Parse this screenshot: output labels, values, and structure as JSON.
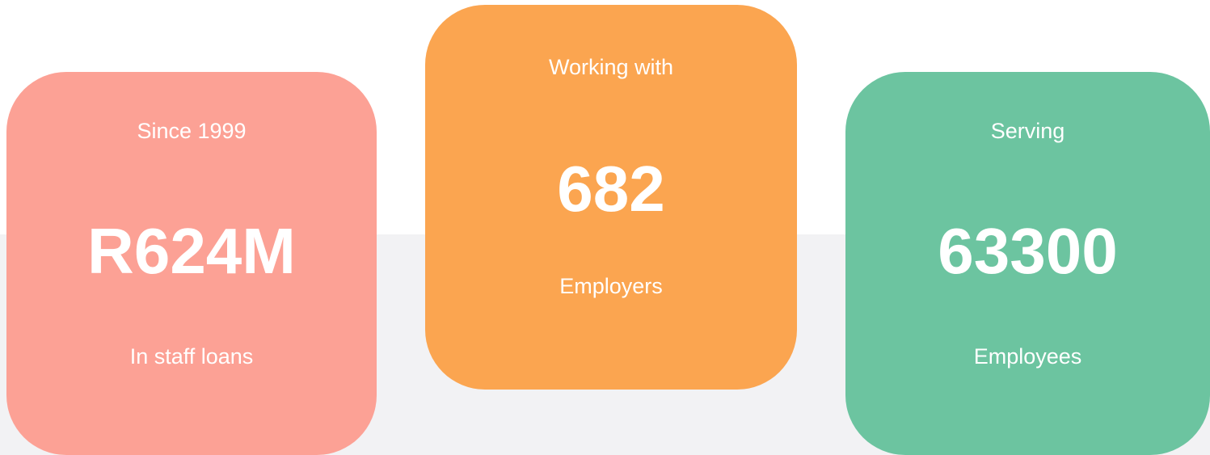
{
  "colors": {
    "background": "#ffffff",
    "band": "#f2f2f4",
    "text": "#ffffff"
  },
  "stats": [
    {
      "top_text": "Since 1999",
      "value": "R624M",
      "bottom_text": "In staff loans",
      "color": "#fca195"
    },
    {
      "top_text": "Working with",
      "value": "682",
      "bottom_text": "Employers",
      "color": "#fba550"
    },
    {
      "top_text": "Serving",
      "value": "63300",
      "bottom_text": "Employees",
      "color": "#6cc4a0"
    }
  ]
}
